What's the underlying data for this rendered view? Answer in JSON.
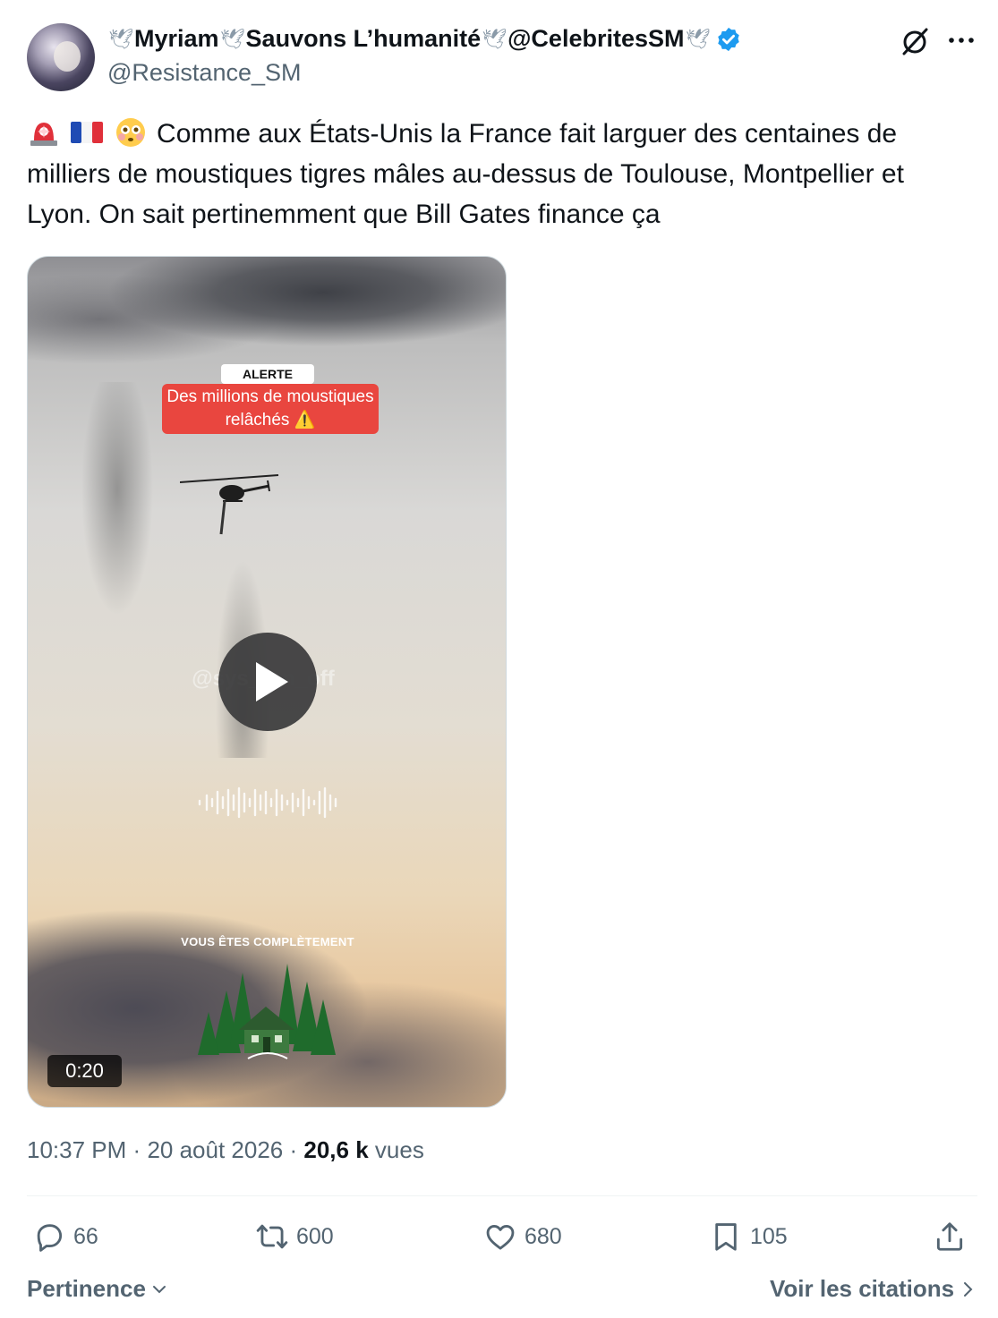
{
  "author": {
    "display_name_parts": [
      "Myriam",
      "Sauvons L’humanité",
      "@CelebritesSM"
    ],
    "handle": "@Resistance_SM",
    "verified": true
  },
  "tweet": {
    "emojis": [
      "police-light-emoji",
      "france-flag-emoji",
      "flushed-face-emoji"
    ],
    "text": "Comme aux États-Unis  la France fait larguer des centaines de milliers de moustiques tigres mâles au-dessus de Toulouse, Montpellier et Lyon. On sait pertinemment que Bill Gates finance ça"
  },
  "media": {
    "alert_label": "ALERTE",
    "alert_title": "Des millions de moustiques relâchés ⚠️",
    "watermark": "@sys_…n_off",
    "caption": "VOUS ÊTES COMPLÈTEMENT",
    "duration": "0:20"
  },
  "meta": {
    "time": "10:37 PM",
    "separator": "·",
    "date": "20 août 2026",
    "views_count": "20,6 k",
    "views_label": "vues"
  },
  "actions": {
    "replies": "66",
    "retweets": "600",
    "likes": "680",
    "bookmarks": "105"
  },
  "footer": {
    "sort_label": "Pertinence",
    "quotes_label": "Voir les citations"
  },
  "colors": {
    "verified": "#1d9bf0",
    "secondary_text": "#536471",
    "alert_red": "#e9463f"
  }
}
